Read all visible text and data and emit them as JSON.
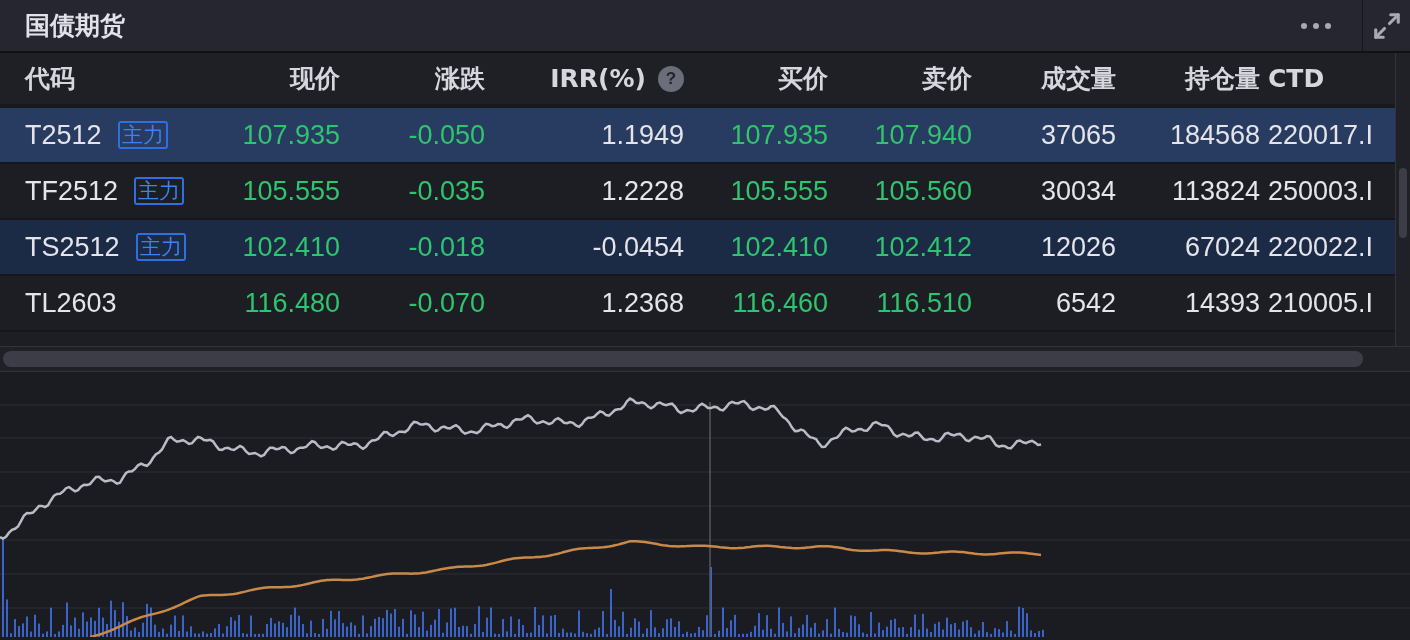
{
  "panel": {
    "title": "国债期货"
  },
  "table": {
    "columns": [
      {
        "label": "代码"
      },
      {
        "label": "现价"
      },
      {
        "label": "涨跌"
      },
      {
        "label": "IRR(%)",
        "help": "?"
      },
      {
        "label": "买价"
      },
      {
        "label": "卖价"
      },
      {
        "label": "成交量"
      },
      {
        "label": "持仓量"
      },
      {
        "label": "CTD"
      }
    ],
    "rows": [
      {
        "selected": true,
        "hovered": false,
        "cells": [
          {
            "text": "T2512",
            "tag": "主力"
          },
          {
            "text": "107.935",
            "color": "#2fc46e"
          },
          {
            "text": "-0.050",
            "color": "#2fc46e"
          },
          {
            "text": "1.1949"
          },
          {
            "text": "107.935",
            "color": "#2fc46e"
          },
          {
            "text": "107.940",
            "color": "#2fc46e"
          },
          {
            "text": "37065"
          },
          {
            "text": "184568"
          },
          {
            "text": "220017.I"
          }
        ]
      },
      {
        "selected": false,
        "hovered": false,
        "cells": [
          {
            "text": "TF2512",
            "tag": "主力"
          },
          {
            "text": "105.555",
            "color": "#2fc46e"
          },
          {
            "text": "-0.035",
            "color": "#2fc46e"
          },
          {
            "text": "1.2228"
          },
          {
            "text": "105.555",
            "color": "#2fc46e"
          },
          {
            "text": "105.560",
            "color": "#2fc46e"
          },
          {
            "text": "30034"
          },
          {
            "text": "113824"
          },
          {
            "text": "250003.I"
          }
        ]
      },
      {
        "selected": false,
        "hovered": true,
        "cells": [
          {
            "text": "TS2512",
            "tag": "主力"
          },
          {
            "text": "102.410",
            "color": "#2fc46e"
          },
          {
            "text": "-0.018",
            "color": "#2fc46e"
          },
          {
            "text": "-0.0454"
          },
          {
            "text": "102.410",
            "color": "#2fc46e"
          },
          {
            "text": "102.412",
            "color": "#2fc46e"
          },
          {
            "text": "12026"
          },
          {
            "text": "67024"
          },
          {
            "text": "220022.I"
          }
        ]
      },
      {
        "selected": false,
        "hovered": false,
        "cells": [
          {
            "text": "TL2603"
          },
          {
            "text": "116.480",
            "color": "#2fc46e"
          },
          {
            "text": "-0.070",
            "color": "#2fc46e"
          },
          {
            "text": "1.2368"
          },
          {
            "text": "116.460",
            "color": "#2fc46e"
          },
          {
            "text": "116.510",
            "color": "#2fc46e"
          },
          {
            "text": "6542"
          },
          {
            "text": "14393"
          },
          {
            "text": "210005.I"
          }
        ]
      }
    ]
  }
}
